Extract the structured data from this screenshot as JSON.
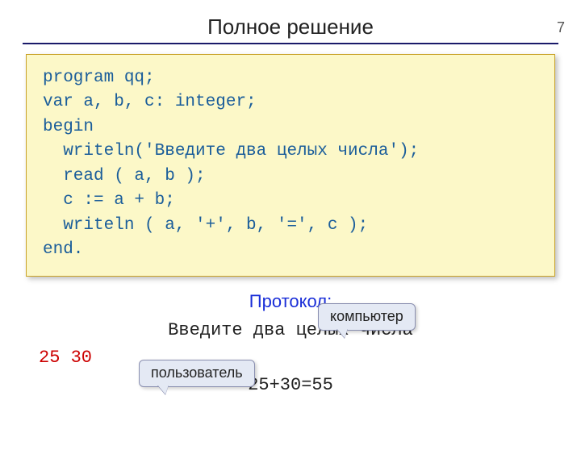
{
  "page_number": "7",
  "title": "Полное решение",
  "code_lines": [
    "program qq;",
    "var a, b, c: integer;",
    "begin",
    "  writeln('Введите два целых числа');",
    "  read ( a, b );",
    "  c := a + b;",
    "  writeln ( a, '+', b, '=', c );",
    "end."
  ],
  "protocol_heading": "Протокол:",
  "console": {
    "prompt": "Введите два целых числа",
    "user_input": "25 30",
    "result": "25+30=55"
  },
  "callouts": {
    "computer": "компьютер",
    "user": "пользователь"
  }
}
